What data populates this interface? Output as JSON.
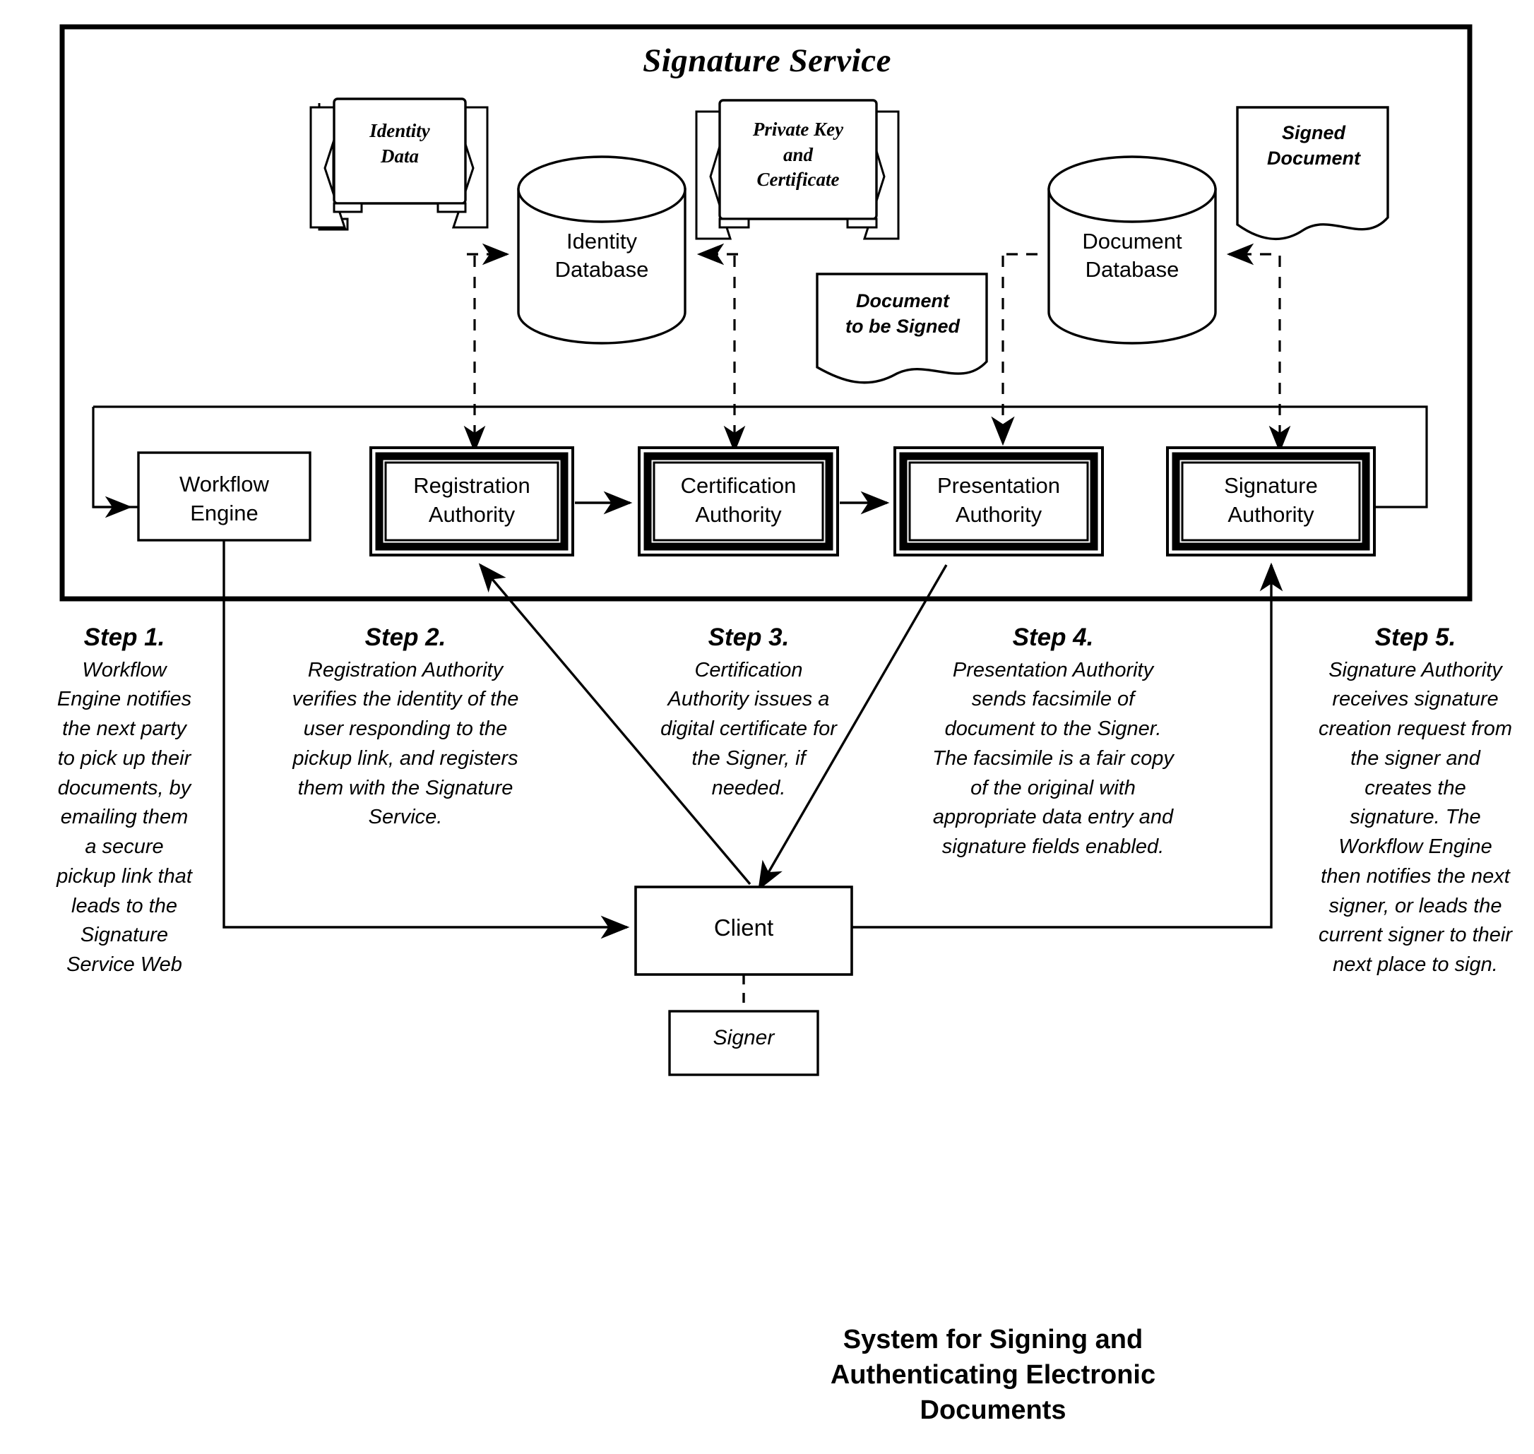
{
  "diagram": {
    "service_title": "Signature Service",
    "caption": "System for Signing and Authenticating Electronic Documents",
    "stores": [
      {
        "id": "identity-data",
        "label_line1": "Identity",
        "label_line2": "Data"
      },
      {
        "id": "private-key-and-certificate",
        "label_line1": "Private Key",
        "label_line2": "and",
        "label_line3": "Certificate"
      }
    ],
    "databases": [
      {
        "id": "identity-database",
        "line1": "Identity",
        "line2": "Database"
      },
      {
        "id": "document-database",
        "line1": "Document",
        "line2": "Database"
      }
    ],
    "documents": [
      {
        "id": "signed-document",
        "line1": "Signed",
        "line2": "Document"
      },
      {
        "id": "document-to-be-signed",
        "line1": "Document",
        "line2": "to be Signed"
      }
    ],
    "nodes": [
      {
        "id": "workflow-engine",
        "line1": "Workflow",
        "line2": "Engine",
        "emphasized": false
      },
      {
        "id": "registration-authority",
        "line1": "Registration",
        "line2": "Authority",
        "emphasized": true
      },
      {
        "id": "certification-authority",
        "line1": "Certification",
        "line2": "Authority",
        "emphasized": true
      },
      {
        "id": "presentation-authority",
        "line1": "Presentation",
        "line2": "Authority",
        "emphasized": true
      },
      {
        "id": "signature-authority",
        "line1": "Signature",
        "line2": "Authority",
        "emphasized": true
      }
    ],
    "client": {
      "id": "client",
      "label": "Client"
    },
    "signer": {
      "id": "signer",
      "label": "Signer"
    },
    "steps": [
      {
        "id": "step-1",
        "heading": "Step 1.",
        "body": "Workflow Engine notifies the next party to pick up their documents, by emailing them a secure pickup link that leads to the Signature Service Web"
      },
      {
        "id": "step-2",
        "heading": "Step 2.",
        "body": "Registration Authority verifies the identity of the user responding to the pickup link, and registers them with the Signature Service."
      },
      {
        "id": "step-3",
        "heading": "Step 3.",
        "body": "Certification Authority issues a digital certificate for the Signer, if needed."
      },
      {
        "id": "step-4",
        "heading": "Step 4.",
        "body": "Presentation Authority sends facsimile of document to the Signer. The facsimile is a fair copy of the original with appropriate data entry and signature fields enabled."
      },
      {
        "id": "step-5",
        "heading": "Step 5.",
        "body": "Signature Authority receives signature creation request from the signer and creates the signature. The Workflow Engine then notifies the next signer, or leads the current signer to their next place to sign."
      }
    ],
    "colors": {
      "stroke": "#000000",
      "fill": "#ffffff",
      "background": "#ffffff"
    }
  }
}
